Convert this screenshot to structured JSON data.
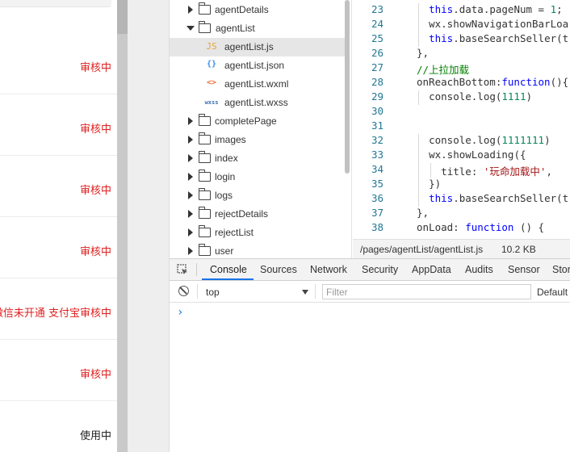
{
  "simulator": {
    "rows": [
      {
        "status": "审核中",
        "color": "#e02020"
      },
      {
        "status": "审核中",
        "color": "#e02020"
      },
      {
        "status": "审核中",
        "color": "#e02020"
      },
      {
        "status": "审核中",
        "color": "#e02020"
      },
      {
        "status": "微信未开通 支付宝审核中",
        "color": "#e02020"
      },
      {
        "status": "审核中",
        "color": "#e02020"
      },
      {
        "status": "使用中",
        "color": "#222222"
      }
    ]
  },
  "tree": {
    "nodes": [
      {
        "label": "agentDetails",
        "type": "folder",
        "expanded": false
      },
      {
        "label": "agentList",
        "type": "folder",
        "expanded": true
      },
      {
        "label": "agentList.js",
        "type": "js",
        "icon": "JS",
        "selected": true
      },
      {
        "label": "agentList.json",
        "type": "json",
        "icon": "{}"
      },
      {
        "label": "agentList.wxml",
        "type": "wxml",
        "icon": "<>"
      },
      {
        "label": "agentList.wxss",
        "type": "wxss",
        "icon": "wxss"
      },
      {
        "label": "completePage",
        "type": "folder",
        "expanded": false
      },
      {
        "label": "images",
        "type": "folder",
        "expanded": false
      },
      {
        "label": "index",
        "type": "folder",
        "expanded": false
      },
      {
        "label": "login",
        "type": "folder",
        "expanded": false
      },
      {
        "label": "logs",
        "type": "folder",
        "expanded": false
      },
      {
        "label": "rejectDetails",
        "type": "folder",
        "expanded": false
      },
      {
        "label": "rejectList",
        "type": "folder",
        "expanded": false
      },
      {
        "label": "user",
        "type": "folder",
        "expanded": false
      }
    ]
  },
  "editor": {
    "lines": [
      {
        "num": "23",
        "indent": 2,
        "tokens": [
          [
            "k",
            "this"
          ],
          [
            "t",
            ".data.pageNum = "
          ],
          [
            "n",
            "1"
          ],
          [
            "t",
            ";"
          ]
        ]
      },
      {
        "num": "24",
        "indent": 2,
        "tokens": [
          [
            "t",
            "wx.showNavigationBarLoa"
          ]
        ]
      },
      {
        "num": "25",
        "indent": 2,
        "tokens": [
          [
            "k",
            "this"
          ],
          [
            "t",
            ".baseSearchSeller(t"
          ]
        ]
      },
      {
        "num": "26",
        "indent": 1,
        "tokens": [
          [
            "t",
            "},"
          ]
        ]
      },
      {
        "num": "27",
        "indent": 1,
        "tokens": [
          [
            "c",
            "//上拉加载"
          ]
        ]
      },
      {
        "num": "28",
        "indent": 1,
        "tokens": [
          [
            "t",
            "onReachBottom:"
          ],
          [
            "k",
            "function"
          ],
          [
            "t",
            "(){"
          ]
        ]
      },
      {
        "num": "29",
        "indent": 2,
        "tokens": [
          [
            "t",
            "console.log("
          ],
          [
            "n",
            "1111"
          ],
          [
            "t",
            ")"
          ]
        ]
      },
      {
        "num": "30",
        "indent": 0,
        "tokens": []
      },
      {
        "num": "31",
        "indent": 0,
        "tokens": []
      },
      {
        "num": "32",
        "indent": 2,
        "tokens": [
          [
            "t",
            "console.log("
          ],
          [
            "n",
            "1111111"
          ],
          [
            "t",
            ")"
          ]
        ]
      },
      {
        "num": "33",
        "indent": 2,
        "tokens": [
          [
            "t",
            "wx.showLoading({"
          ]
        ]
      },
      {
        "num": "34",
        "indent": 3,
        "tokens": [
          [
            "t",
            "title: "
          ],
          [
            "s",
            "'玩命加载中'"
          ],
          [
            "t",
            ","
          ]
        ]
      },
      {
        "num": "35",
        "indent": 2,
        "tokens": [
          [
            "t",
            "})"
          ]
        ]
      },
      {
        "num": "36",
        "indent": 2,
        "tokens": [
          [
            "k",
            "this"
          ],
          [
            "t",
            ".baseSearchSeller(t"
          ]
        ]
      },
      {
        "num": "37",
        "indent": 1,
        "tokens": [
          [
            "t",
            "},"
          ]
        ]
      },
      {
        "num": "38",
        "indent": 1,
        "tokens": [
          [
            "t",
            "onLoad: "
          ],
          [
            "k",
            "function"
          ],
          [
            "t",
            " () {"
          ]
        ]
      }
    ]
  },
  "statusbar": {
    "path": "/pages/agentList/agentList.js",
    "size": "10.2 KB"
  },
  "devtools": {
    "tabs": [
      "Console",
      "Sources",
      "Network",
      "Security",
      "AppData",
      "Audits",
      "Sensor",
      "Stor"
    ],
    "active_tab": "Console",
    "accent": "#1a73e8",
    "context": "top",
    "filter_placeholder": "Filter",
    "levels": "Default",
    "prompt": "›"
  }
}
